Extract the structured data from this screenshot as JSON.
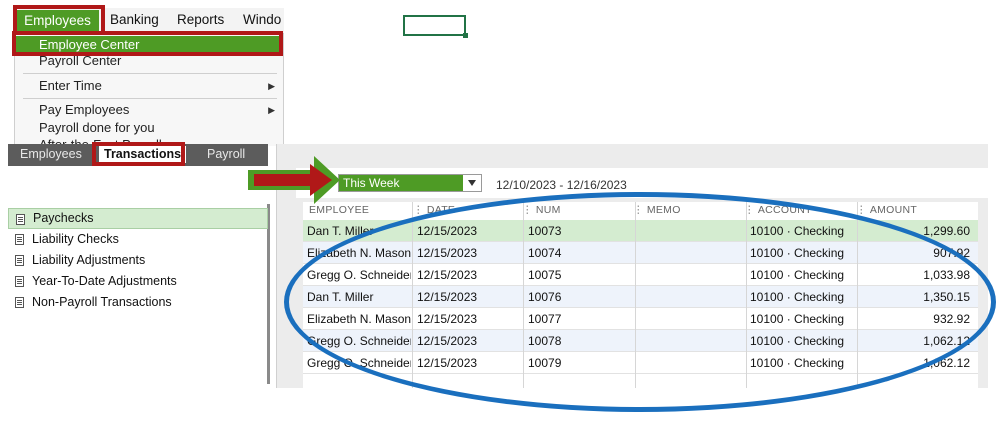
{
  "menubar": {
    "items": [
      {
        "label": "Employees"
      },
      {
        "label": "Banking"
      },
      {
        "label": "Reports"
      },
      {
        "label": "Windo"
      }
    ]
  },
  "dropdown": {
    "items": [
      {
        "label": "Employee Center"
      },
      {
        "label": "Payroll Center"
      },
      {
        "label": "Enter Time"
      },
      {
        "label": "Pay Employees"
      },
      {
        "label": "Payroll done for you"
      },
      {
        "label": "After-the-Fact Payroll"
      }
    ]
  },
  "tabs": [
    {
      "label": "Employees"
    },
    {
      "label": "Transactions"
    },
    {
      "label": "Payroll"
    }
  ],
  "transaction_types": [
    {
      "label": "Paychecks"
    },
    {
      "label": "Liability Checks"
    },
    {
      "label": "Liability Adjustments"
    },
    {
      "label": "Year-To-Date Adjustments"
    },
    {
      "label": "Non-Payroll Transactions"
    }
  ],
  "filter": {
    "period": "This Week",
    "date_range": "12/10/2023 - 12/16/2023"
  },
  "table": {
    "headers": [
      "EMPLOYEE",
      "DATE",
      "NUM",
      "MEMO",
      "ACCOUNT",
      "AMOUNT"
    ],
    "rows": [
      {
        "employee": "Dan T. Miller",
        "date": "12/15/2023",
        "num": "10073",
        "memo": "",
        "account": "10100 · Checking",
        "amount": "1,299.60"
      },
      {
        "employee": "Elizabeth N. Mason",
        "date": "12/15/2023",
        "num": "10074",
        "memo": "",
        "account": "10100 · Checking",
        "amount": "907.92"
      },
      {
        "employee": "Gregg O. Schneider",
        "date": "12/15/2023",
        "num": "10075",
        "memo": "",
        "account": "10100 · Checking",
        "amount": "1,033.98"
      },
      {
        "employee": "Dan T. Miller",
        "date": "12/15/2023",
        "num": "10076",
        "memo": "",
        "account": "10100 · Checking",
        "amount": "1,350.15"
      },
      {
        "employee": "Elizabeth N. Mason",
        "date": "12/15/2023",
        "num": "10077",
        "memo": "",
        "account": "10100 · Checking",
        "amount": "932.92"
      },
      {
        "employee": "Gregg O. Schneider",
        "date": "12/15/2023",
        "num": "10078",
        "memo": "",
        "account": "10100 · Checking",
        "amount": "1,062.12"
      },
      {
        "employee": "Gregg O. Schneider",
        "date": "12/15/2023",
        "num": "10079",
        "memo": "",
        "account": "10100 · Checking",
        "amount": "1,062.12"
      }
    ]
  },
  "colors": {
    "accent_green": "#4e9b25",
    "highlight_red": "#b01818",
    "annotation_blue": "#1a6fbe",
    "selected_row": "#d4ecd0"
  },
  "icons": {
    "list_item": "document-icon",
    "arrow": "arrow-right-icon",
    "caret": "chevron-down-icon"
  }
}
